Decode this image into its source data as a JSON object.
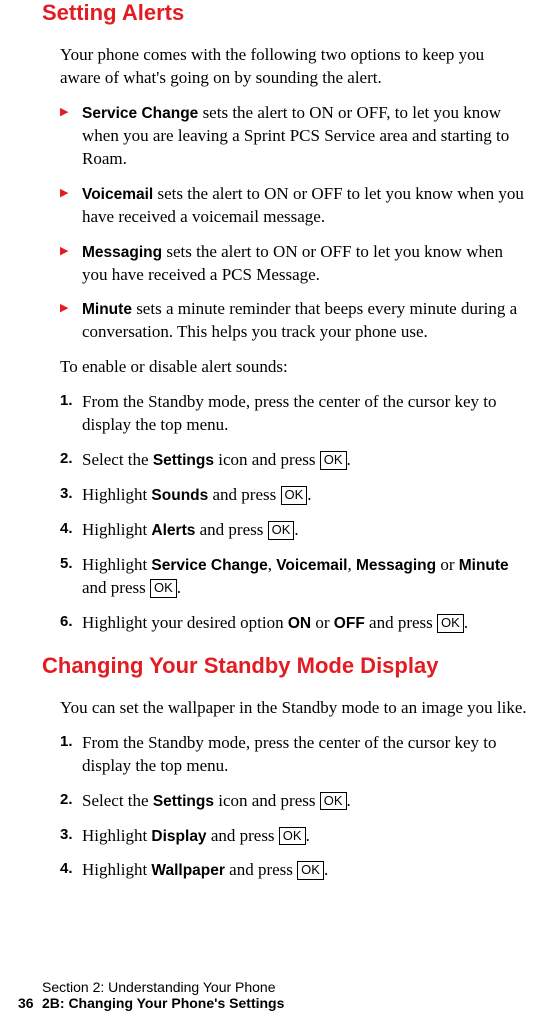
{
  "section1": {
    "heading": "Setting Alerts",
    "intro": "Your phone comes with the following two options to keep you aware of what's going on by sounding the alert.",
    "bullets": [
      {
        "bold": "Service Change",
        "text": " sets the alert to ON or OFF, to let you know when you are leaving a Sprint PCS Service area and starting to Roam."
      },
      {
        "bold": "Voicemail",
        "text": " sets the alert to ON or OFF to let you know when you have received a voicemail message."
      },
      {
        "bold": "Messaging",
        "text": " sets the alert to ON or OFF to let you know when you have received a PCS Message."
      },
      {
        "bold": "Minute",
        "text": " sets a minute reminder that beeps every minute during a conversation. This helps you track your phone use."
      }
    ],
    "subtext": "To enable or disable alert sounds:",
    "steps": {
      "s1": "From the Standby mode, press the center of the cursor key to display the top menu.",
      "s2a": "Select the ",
      "s2b": "Settings",
      "s2c": " icon and press ",
      "s3a": "Highlight ",
      "s3b": "Sounds",
      "s3c": " and press ",
      "s4a": "Highlight ",
      "s4b": "Alerts",
      "s4c": " and press ",
      "s5a": "Highlight ",
      "s5b": "Service Change",
      "s5c": ", ",
      "s5d": "Voicemail",
      "s5e": ", ",
      "s5f": "Messaging",
      "s5g": " or ",
      "s5h": "Minute",
      "s5i": " and press ",
      "s6a": "Highlight your desired option ",
      "s6b": "ON",
      "s6c": " or ",
      "s6d": "OFF",
      "s6e": " and press "
    }
  },
  "section2": {
    "heading": "Changing Your Standby Mode Display",
    "intro": "You can set the wallpaper in the Standby mode to an image you like.",
    "steps": {
      "s1": "From the Standby mode, press the center of the cursor key to display the top menu.",
      "s2a": "Select the ",
      "s2b": "Settings",
      "s2c": " icon and press ",
      "s3a": "Highlight ",
      "s3b": "Display",
      "s3c": " and press ",
      "s4a": "Highlight ",
      "s4b": "Wallpaper",
      "s4c": " and press "
    }
  },
  "ok": "OK",
  "period": ".",
  "footer": {
    "line1": "Section 2: Understanding Your Phone",
    "pagenum": "36",
    "line2": "2B: Changing Your Phone's Settings"
  }
}
